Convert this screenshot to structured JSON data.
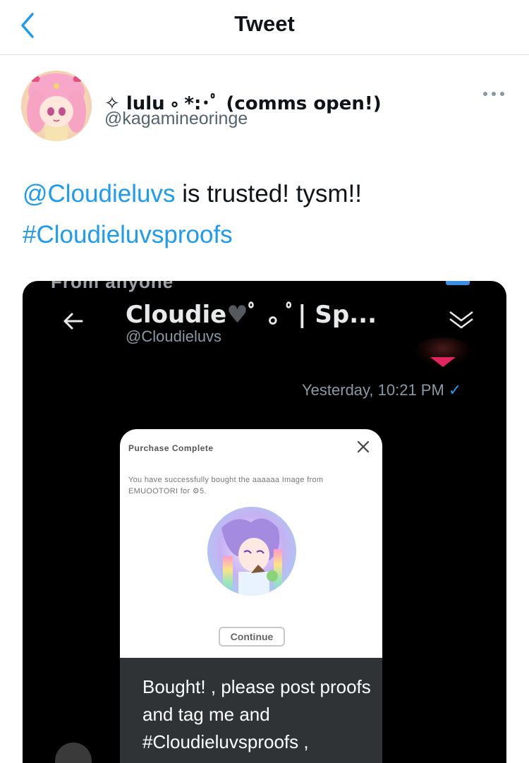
{
  "header": {
    "title": "Tweet"
  },
  "author": {
    "display_name": "✧ lulu ༚ *:･ﾟ (comms open!)",
    "handle": "@kagamineoringe"
  },
  "tweet": {
    "mention": "@Cloudieluvs",
    "text_after_mention": " is trusted! tysm!!",
    "hashtag": "#Cloudieluvsproofs"
  },
  "media": {
    "top_sliver_text": "From anyone",
    "dm_header": {
      "name": "Cloudie",
      "name_suffix": "ﾟ ｡ ﾟ| Sp...",
      "handle": "@Cloudieluvs"
    },
    "timestamp": "Yesterday, 10:21 PM",
    "purchase_card": {
      "title": "Purchase Complete",
      "text": "You have successfully bought the aaaaaa Image from EMUOOTORI for ⚙5.",
      "button_label": "Continue"
    },
    "message": "Bought! , please post proofs and tag me and #Cloudieluvsproofs ,"
  },
  "icons": {
    "back": "chevron-left-icon",
    "more": "ellipsis-icon",
    "dm_back": "arrow-left-icon",
    "dm_chevron": "double-chevron-down-icon",
    "close": "close-icon",
    "check": "check-icon"
  },
  "colors": {
    "accent": "#1d9bf0",
    "text": "#0f1419",
    "secondary": "#536471",
    "media_bg": "#000000"
  }
}
